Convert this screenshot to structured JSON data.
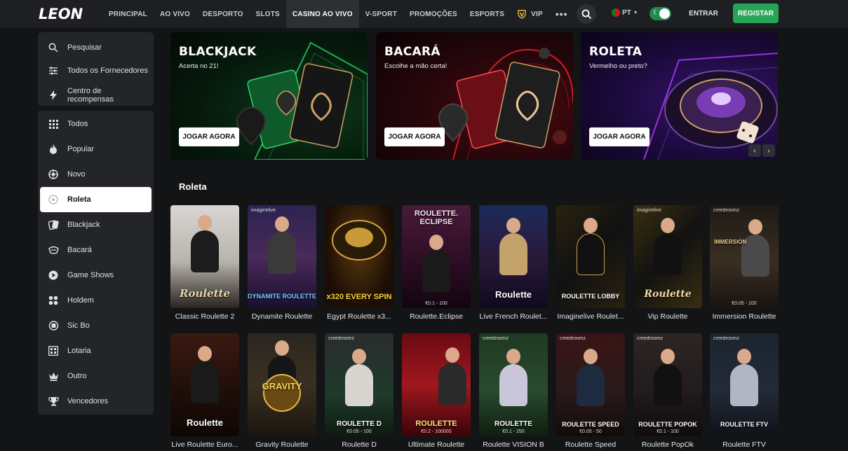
{
  "header": {
    "logo": "LEON",
    "nav": [
      "PRINCIPAL",
      "AO VIVO",
      "DESPORTO",
      "SLOTS",
      "CASINO AO VIVO",
      "V-SPORT",
      "PROMOÇÕES",
      "ESPORTS",
      "VIP"
    ],
    "more": "•••",
    "language": "PT",
    "login_label": "ENTRAR",
    "register_label": "REGISTAR"
  },
  "sidebar_top": [
    {
      "label": "Pesquisar",
      "icon": "search-icon"
    },
    {
      "label": "Todos os Fornecedores",
      "icon": "sliders-icon"
    },
    {
      "label": "Centro de recompensas",
      "icon": "lightning-icon"
    }
  ],
  "sidebar": [
    {
      "label": "Todos",
      "icon": "grid-icon"
    },
    {
      "label": "Popular",
      "icon": "flame-icon"
    },
    {
      "label": "Novo",
      "icon": "new-badge-icon"
    },
    {
      "label": "Roleta",
      "icon": "roulette-icon"
    },
    {
      "label": "Blackjack",
      "icon": "cards-icon"
    },
    {
      "label": "Bacará",
      "icon": "baccarat-icon"
    },
    {
      "label": "Game Shows",
      "icon": "play-icon"
    },
    {
      "label": "Holdem",
      "icon": "chips-icon"
    },
    {
      "label": "Sic Bo",
      "icon": "dice-icon"
    },
    {
      "label": "Lotaria",
      "icon": "lottery-icon"
    },
    {
      "label": "Outro",
      "icon": "crown-icon"
    },
    {
      "label": "Vencedores",
      "icon": "trophy-icon"
    }
  ],
  "banners": [
    {
      "title": "BLACKJACK",
      "subtitle": "Acerta no 21!",
      "button": "JOGAR AGORA",
      "accent": "#1ed760"
    },
    {
      "title": "BACARÁ",
      "subtitle": "Escolhe a mão certa!",
      "button": "JOGAR AGORA",
      "accent": "#e0202a"
    },
    {
      "title": "ROLETA",
      "subtitle": "Vermelho ou preto?",
      "button": "JOGAR AGORA",
      "accent": "#b43cff"
    }
  ],
  "section_title": "Roleta",
  "games_row1": [
    {
      "name": "Classic Roulette 2",
      "brand": "Roulette",
      "limit": "",
      "provider": ""
    },
    {
      "name": "Dynamite Roulette",
      "brand": "DYNAMITE ROULETTE",
      "limit": "",
      "provider": "imaginelive"
    },
    {
      "name": "Egypt Roulette x3...",
      "brand": "x320 EVERY SPIN",
      "limit": "",
      "provider": ""
    },
    {
      "name": "Roulette.Eclipse",
      "brand": "ROULETTE. ECLIPSE",
      "limit": "€0.1 - 100",
      "provider": ""
    },
    {
      "name": "Live French Roulet...",
      "brand": "Roulette",
      "limit": "",
      "provider": ""
    },
    {
      "name": "Imaginelive Roulet...",
      "brand": "ROULETTE LOBBY",
      "limit": "",
      "provider": "imaginelive"
    },
    {
      "name": "Vip Roulette",
      "brand": "Roulette",
      "limit": "",
      "provider": "imaginelive"
    },
    {
      "name": "Immersion Roulette",
      "brand": "IMMERSION",
      "limit": "€0.05 - 100",
      "provider": "creedroomz"
    }
  ],
  "games_row2": [
    {
      "name": "Live Roulette Euro...",
      "brand": "Roulette",
      "limit": "",
      "provider": ""
    },
    {
      "name": "Gravity Roulette",
      "brand": "GRAVITY",
      "limit": "",
      "provider": ""
    },
    {
      "name": "Roulette D",
      "brand": "ROULETTE D",
      "limit": "€0.05 - 100",
      "provider": "creedroomz"
    },
    {
      "name": "Ultimate Roulette",
      "brand": "ROULETTE",
      "limit": "€0.2 - 100000",
      "provider": ""
    },
    {
      "name": "Roulette VISION B",
      "brand": "ROULETTE",
      "limit": "€0.1 - 250",
      "provider": "creedroomz"
    },
    {
      "name": "Roulette Speed",
      "brand": "ROULETTE SPEED",
      "limit": "€0.05 - 50",
      "provider": "creedroomz"
    },
    {
      "name": "Roulette PopOk",
      "brand": "ROULETTE POPOK",
      "limit": "€0.1 - 100",
      "provider": "creedroomz"
    },
    {
      "name": "Roulette FTV",
      "brand": "ROULETTE FTV",
      "limit": "",
      "provider": "creedroomz"
    }
  ]
}
